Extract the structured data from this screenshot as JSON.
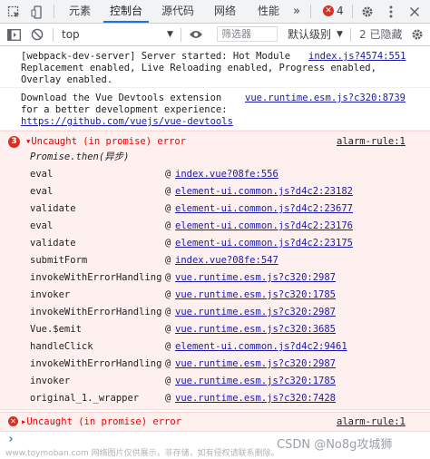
{
  "tabs": [
    "元素",
    "控制台",
    "源代码",
    "网络",
    "性能"
  ],
  "error_count": "4",
  "toolbar": {
    "context": "top",
    "filter_placeholder": "筛选器",
    "levels": "默认级别",
    "hidden": "2 已隐藏"
  },
  "messages": [
    {
      "lines": [
        "[webpack-dev-server] Server started: Hot Module",
        "Replacement enabled, Live Reloading enabled, Progress enabled,",
        "Overlay enabled."
      ],
      "source": "index.js?4574:551"
    },
    {
      "lines": [
        "Download the Vue Devtools extension",
        "for a better development experience:"
      ],
      "link": "https://github.com/vuejs/vue-devtools",
      "source": "vue.runtime.esm.js?c320:8739"
    }
  ],
  "error1": {
    "count": "3",
    "title": "▾Uncaught (in promise) error",
    "source": "alarm-rule:1",
    "promise_line": "Promise.then(异步)",
    "stack": [
      {
        "fn": "eval",
        "file": "index.vue?08fe:556"
      },
      {
        "fn": "eval",
        "file": "element-ui.common.js?d4c2:23182"
      },
      {
        "fn": "validate",
        "file": "element-ui.common.js?d4c2:23677"
      },
      {
        "fn": "eval",
        "file": "element-ui.common.js?d4c2:23176"
      },
      {
        "fn": "validate",
        "file": "element-ui.common.js?d4c2:23175"
      },
      {
        "fn": "submitForm",
        "file": "index.vue?08fe:547"
      },
      {
        "fn": "invokeWithErrorHandling",
        "file": "vue.runtime.esm.js?c320:2987"
      },
      {
        "fn": "invoker",
        "file": "vue.runtime.esm.js?c320:1785"
      },
      {
        "fn": "invokeWithErrorHandling",
        "file": "vue.runtime.esm.js?c320:2987"
      },
      {
        "fn": "Vue.$emit",
        "file": "vue.runtime.esm.js?c320:3685"
      },
      {
        "fn": "handleClick",
        "file": "element-ui.common.js?d4c2:9461"
      },
      {
        "fn": "invokeWithErrorHandling",
        "file": "vue.runtime.esm.js?c320:2987"
      },
      {
        "fn": "invoker",
        "file": "vue.runtime.esm.js?c320:1785"
      },
      {
        "fn": "original_1._wrapper",
        "file": "vue.runtime.esm.js?c320:7428"
      }
    ]
  },
  "error2": {
    "title": "▸Uncaught (in promise) error",
    "source": "alarm-rule:1"
  },
  "prompt": "›",
  "watermark": {
    "csdn": "CSDN @No8g攻城狮",
    "site": "www.toymoban.com 网络图片仅供展示，非存储，如有侵权请联系删除。"
  },
  "colors": {
    "error_red": "#d93025",
    "link_blue": "#1a1aa6",
    "error_bg": "#fff0f0",
    "active_tab": "#1a73e8"
  }
}
